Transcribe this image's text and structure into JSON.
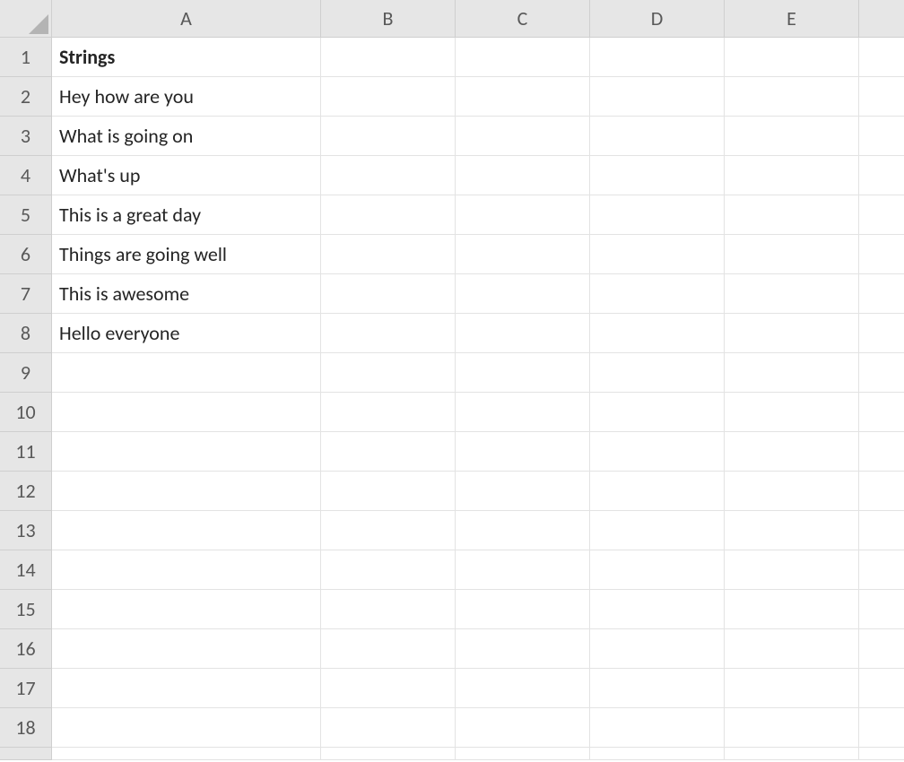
{
  "columns": [
    "A",
    "B",
    "C",
    "D",
    "E",
    ""
  ],
  "rows": [
    {
      "num": "1",
      "a": "Strings",
      "bold": true
    },
    {
      "num": "2",
      "a": "Hey how are you",
      "bold": false
    },
    {
      "num": "3",
      "a": "What is going on",
      "bold": false
    },
    {
      "num": "4",
      "a": "What's up",
      "bold": false
    },
    {
      "num": "5",
      "a": "This is a great day",
      "bold": false
    },
    {
      "num": "6",
      "a": "Things are going well",
      "bold": false
    },
    {
      "num": "7",
      "a": "This is awesome",
      "bold": false
    },
    {
      "num": "8",
      "a": "Hello everyone",
      "bold": false
    },
    {
      "num": "9",
      "a": "",
      "bold": false
    },
    {
      "num": "10",
      "a": "",
      "bold": false
    },
    {
      "num": "11",
      "a": "",
      "bold": false
    },
    {
      "num": "12",
      "a": "",
      "bold": false
    },
    {
      "num": "13",
      "a": "",
      "bold": false
    },
    {
      "num": "14",
      "a": "",
      "bold": false
    },
    {
      "num": "15",
      "a": "",
      "bold": false
    },
    {
      "num": "16",
      "a": "",
      "bold": false
    },
    {
      "num": "17",
      "a": "",
      "bold": false
    },
    {
      "num": "18",
      "a": "",
      "bold": false
    }
  ],
  "partialRowNum": "10"
}
